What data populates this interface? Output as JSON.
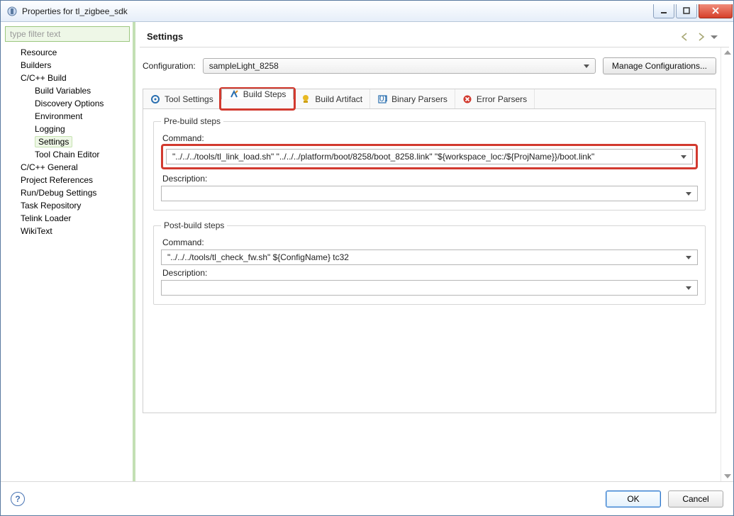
{
  "window": {
    "title": "Properties for tl_zigbee_sdk"
  },
  "filter_placeholder": "type filter text",
  "tree": [
    {
      "label": "Resource",
      "level": 0
    },
    {
      "label": "Builders",
      "level": 0
    },
    {
      "label": "C/C++ Build",
      "level": 0
    },
    {
      "label": "Build Variables",
      "level": 1
    },
    {
      "label": "Discovery Options",
      "level": 1
    },
    {
      "label": "Environment",
      "level": 1
    },
    {
      "label": "Logging",
      "level": 1
    },
    {
      "label": "Settings",
      "level": 1,
      "selected": true
    },
    {
      "label": "Tool Chain Editor",
      "level": 1
    },
    {
      "label": "C/C++ General",
      "level": 0
    },
    {
      "label": "Project References",
      "level": 0
    },
    {
      "label": "Run/Debug Settings",
      "level": 0
    },
    {
      "label": "Task Repository",
      "level": 0
    },
    {
      "label": "Telink Loader",
      "level": 0
    },
    {
      "label": "WikiText",
      "level": 0
    }
  ],
  "page_title": "Settings",
  "configuration": {
    "label": "Configuration:",
    "value": "sampleLight_8258",
    "manage_btn": "Manage Configurations..."
  },
  "tabs": [
    {
      "label": "Tool Settings",
      "icon": "tool-settings-icon"
    },
    {
      "label": "Build Steps",
      "icon": "build-steps-icon",
      "active": true,
      "highlighted": true
    },
    {
      "label": "Build Artifact",
      "icon": "build-artifact-icon"
    },
    {
      "label": "Binary Parsers",
      "icon": "binary-parsers-icon"
    },
    {
      "label": "Error Parsers",
      "icon": "error-parsers-icon"
    }
  ],
  "pre_build": {
    "legend": "Pre-build steps",
    "command_label": "Command:",
    "command_value": "\"../../../tools/tl_link_load.sh\" \"../../../platform/boot/8258/boot_8258.link\" \"${workspace_loc:/${ProjName}}/boot.link\"",
    "description_label": "Description:",
    "description_value": ""
  },
  "post_build": {
    "legend": "Post-build steps",
    "command_label": "Command:",
    "command_value": "\"../../../tools/tl_check_fw.sh\" ${ConfigName} tc32",
    "description_label": "Description:",
    "description_value": ""
  },
  "footer": {
    "ok": "OK",
    "cancel": "Cancel"
  }
}
